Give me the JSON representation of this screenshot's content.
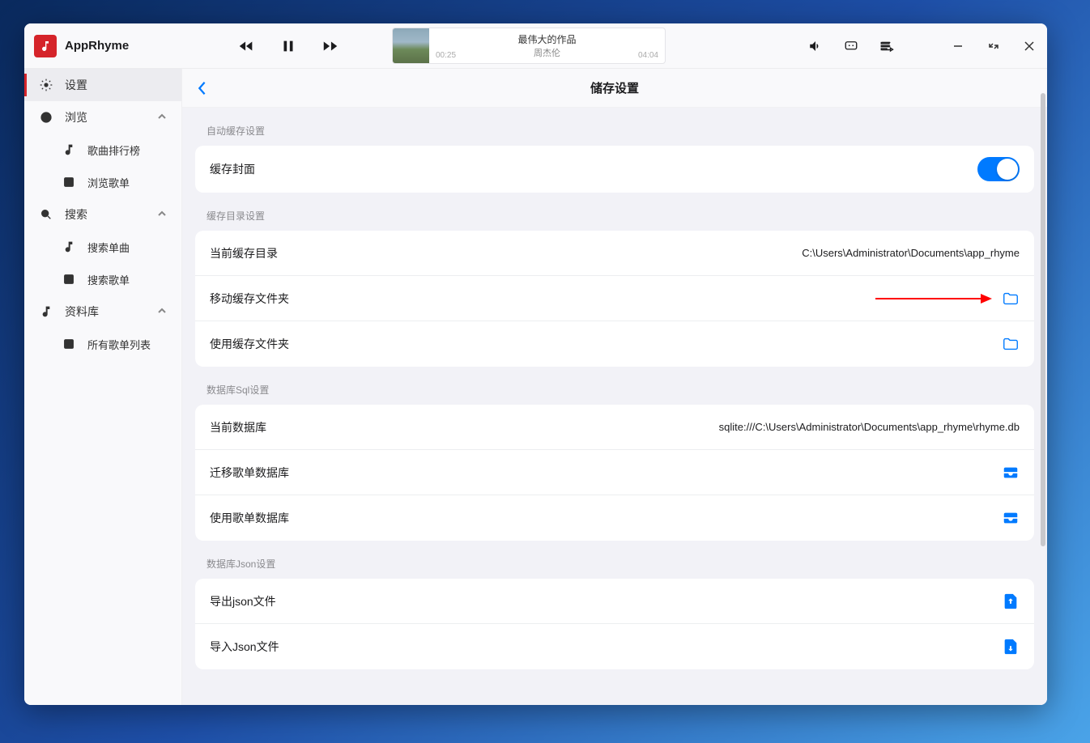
{
  "app": {
    "name": "AppRhyme"
  },
  "player": {
    "title": "最伟大的作品",
    "artist": "周杰伦",
    "elapsed": "00:25",
    "duration": "04:04"
  },
  "sidebar": {
    "settings": "设置",
    "browse": "浏览",
    "songRanking": "歌曲排行榜",
    "browsePlaylists": "浏览歌单",
    "search": "搜索",
    "searchSongs": "搜索单曲",
    "searchPlaylists": "搜索歌单",
    "library": "资料库",
    "allPlaylists": "所有歌单列表"
  },
  "page": {
    "title": "储存设置",
    "sections": {
      "autoCache": "自动缓存设置",
      "cacheDir": "缓存目录设置",
      "dbSql": "数据库Sql设置",
      "dbJson": "数据库Json设置"
    },
    "rows": {
      "cacheCover": "缓存封面",
      "currentCacheDir": {
        "label": "当前缓存目录",
        "value": "C:\\Users\\Administrator\\Documents\\app_rhyme"
      },
      "moveCacheFolder": "移动缓存文件夹",
      "useCacheFolder": "使用缓存文件夹",
      "currentDb": {
        "label": "当前数据库",
        "value": "sqlite:///C:\\Users\\Administrator\\Documents\\app_rhyme\\rhyme.db"
      },
      "migratePlaylistDb": "迁移歌单数据库",
      "usePlaylistDb": "使用歌单数据库",
      "exportJson": "导出json文件",
      "importJson": "导入Json文件"
    }
  }
}
